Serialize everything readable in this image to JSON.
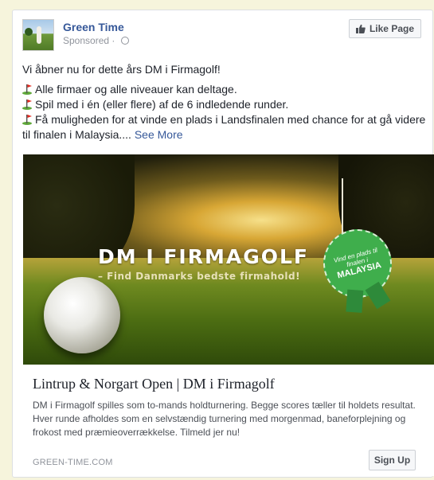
{
  "post": {
    "page_name": "Green Time",
    "sponsored": "Sponsored · ",
    "like_button": "Like Page",
    "intro": "Vi åbner nu for dette års DM i Firmagolf!",
    "bullets": [
      "Alle firmaer og alle niveauer kan deltage.",
      "Spil med i én (eller flere) af de 6 indledende runder.",
      "Få muligheden for at vinde en plads i Landsfinalen med chance for at gå videre til finalen i Malaysia.... "
    ],
    "see_more": "See More"
  },
  "ad_image": {
    "title": "DM I FIRMAGOLF",
    "subtitle": "– Find Danmarks bedste firmahold!",
    "badge_line1": "Vind en plads til finalen i",
    "badge_line2": "MALAYSIA"
  },
  "link": {
    "title": "Lintrup & Norgart Open | DM i Firmagolf",
    "description": "DM i Firmagolf spilles som to-mands holdturnering. Begge scores tæller til holdets resultat. Hver runde afholdes som en selvstændig turnering med morgenmad, baneforplejning og frokost med præmieoverrækkelse. Tilmeld jer nu!",
    "domain": "GREEN-TIME.COM",
    "cta": "Sign Up"
  },
  "colors": {
    "link_blue": "#365899",
    "background": "#f6f4dc",
    "badge_green": "#3fae4c"
  }
}
